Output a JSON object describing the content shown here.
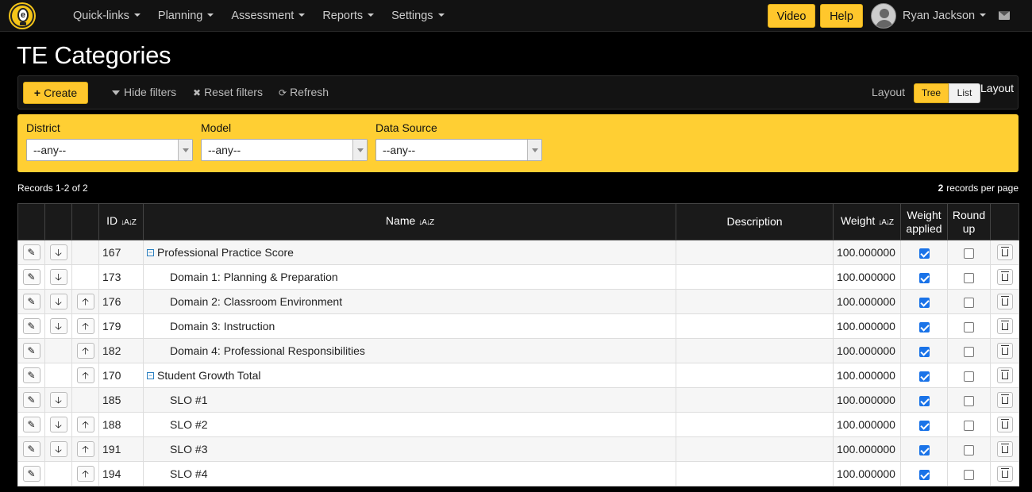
{
  "nav": {
    "menu": [
      "Quick-links",
      "Planning",
      "Assessment",
      "Reports",
      "Settings"
    ],
    "video_label": "Video",
    "help_label": "Help",
    "user_name": "Ryan Jackson"
  },
  "page": {
    "title": "TE Categories"
  },
  "toolbar": {
    "create_label": "Create",
    "hide_filters": "Hide filters",
    "reset_filters": "Reset filters",
    "refresh": "Refresh",
    "layout_label": "Layout",
    "tree_label": "Tree",
    "list_label": "List",
    "layout_tail": "Layout"
  },
  "filters": {
    "district": {
      "label": "District",
      "value": "--any--"
    },
    "model": {
      "label": "Model",
      "value": "--any--"
    },
    "data_source": {
      "label": "Data Source",
      "value": "--any--"
    }
  },
  "records": {
    "summary": "Records 1-2 of 2",
    "per_page_count": "2",
    "per_page_label": "records per page"
  },
  "table": {
    "headers": {
      "id": "ID",
      "name": "Name",
      "description": "Description",
      "weight": "Weight",
      "weight_applied": "Weight applied",
      "round_up": "Round up"
    },
    "rows": [
      {
        "id": "167",
        "name": "Professional Practice Score",
        "level": 0,
        "group": true,
        "description": "",
        "weight": "100.000000",
        "down": true,
        "up": false,
        "weight_applied": true,
        "round_up": false
      },
      {
        "id": "173",
        "name": "Domain 1: Planning & Preparation",
        "level": 1,
        "group": false,
        "description": "",
        "weight": "100.000000",
        "down": true,
        "up": false,
        "weight_applied": true,
        "round_up": false
      },
      {
        "id": "176",
        "name": "Domain 2: Classroom Environment",
        "level": 1,
        "group": false,
        "description": "",
        "weight": "100.000000",
        "down": true,
        "up": true,
        "weight_applied": true,
        "round_up": false
      },
      {
        "id": "179",
        "name": "Domain 3: Instruction",
        "level": 1,
        "group": false,
        "description": "",
        "weight": "100.000000",
        "down": true,
        "up": true,
        "weight_applied": true,
        "round_up": false
      },
      {
        "id": "182",
        "name": "Domain 4: Professional Responsibilities",
        "level": 1,
        "group": false,
        "description": "",
        "weight": "100.000000",
        "down": false,
        "up": true,
        "weight_applied": true,
        "round_up": false
      },
      {
        "id": "170",
        "name": "Student Growth Total",
        "level": 0,
        "group": true,
        "description": "",
        "weight": "100.000000",
        "down": false,
        "up": true,
        "weight_applied": true,
        "round_up": false
      },
      {
        "id": "185",
        "name": "SLO #1",
        "level": 1,
        "group": false,
        "description": "",
        "weight": "100.000000",
        "down": true,
        "up": false,
        "weight_applied": true,
        "round_up": false
      },
      {
        "id": "188",
        "name": "SLO #2",
        "level": 1,
        "group": false,
        "description": "",
        "weight": "100.000000",
        "down": true,
        "up": true,
        "weight_applied": true,
        "round_up": false
      },
      {
        "id": "191",
        "name": "SLO #3",
        "level": 1,
        "group": false,
        "description": "",
        "weight": "100.000000",
        "down": true,
        "up": true,
        "weight_applied": true,
        "round_up": false
      },
      {
        "id": "194",
        "name": "SLO #4",
        "level": 1,
        "group": false,
        "description": "",
        "weight": "100.000000",
        "down": false,
        "up": true,
        "weight_applied": true,
        "round_up": false
      }
    ]
  }
}
